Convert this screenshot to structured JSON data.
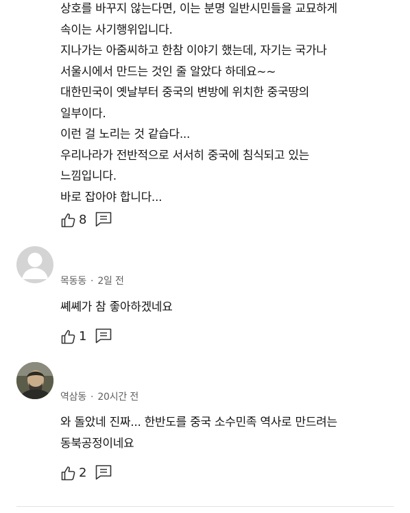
{
  "comments": [
    {
      "lines": [
        "상호를 바꾸지 않는다면, 이는 분명 일반시민들을 교묘하게",
        "속이는 사기행위입니다.",
        "지나가는 아줌씨하고 한참 이야기 했는데, 자기는 국가나",
        "서울시에서 만드는 것인 줄 알았다 하데요~~",
        "대한민국이 옛날부터 중국의 변방에 위치한 중국땅의",
        "일부이다.",
        "이런 걸 노리는 것 같습다...",
        "우리나라가 전반적으로 서서히 중국에 침식되고 있는",
        "느낌입니다.",
        "바로 잡아야 합니다..."
      ],
      "likes": "8"
    },
    {
      "author": "목동동",
      "separator": "·",
      "time": "2일 전",
      "lines": [
        "쎼쎼가 참 좋아하겠네요"
      ],
      "likes": "1",
      "avatar": "default-avatar"
    },
    {
      "author": "역삼동",
      "separator": "·",
      "time": "20시간 전",
      "lines": [
        "와 돌았네 진짜... 한반도를 중국 소수민족 역사로 만드려는",
        "동북공정이네요"
      ],
      "likes": "2",
      "avatar": "photo-avatar"
    }
  ],
  "icons": {
    "like": "thumbs-up-icon",
    "reply": "reply-comment-icon"
  },
  "colors": {
    "text": "#151515",
    "meta": "#606060",
    "avatar_bg": "#d4d4d4"
  }
}
